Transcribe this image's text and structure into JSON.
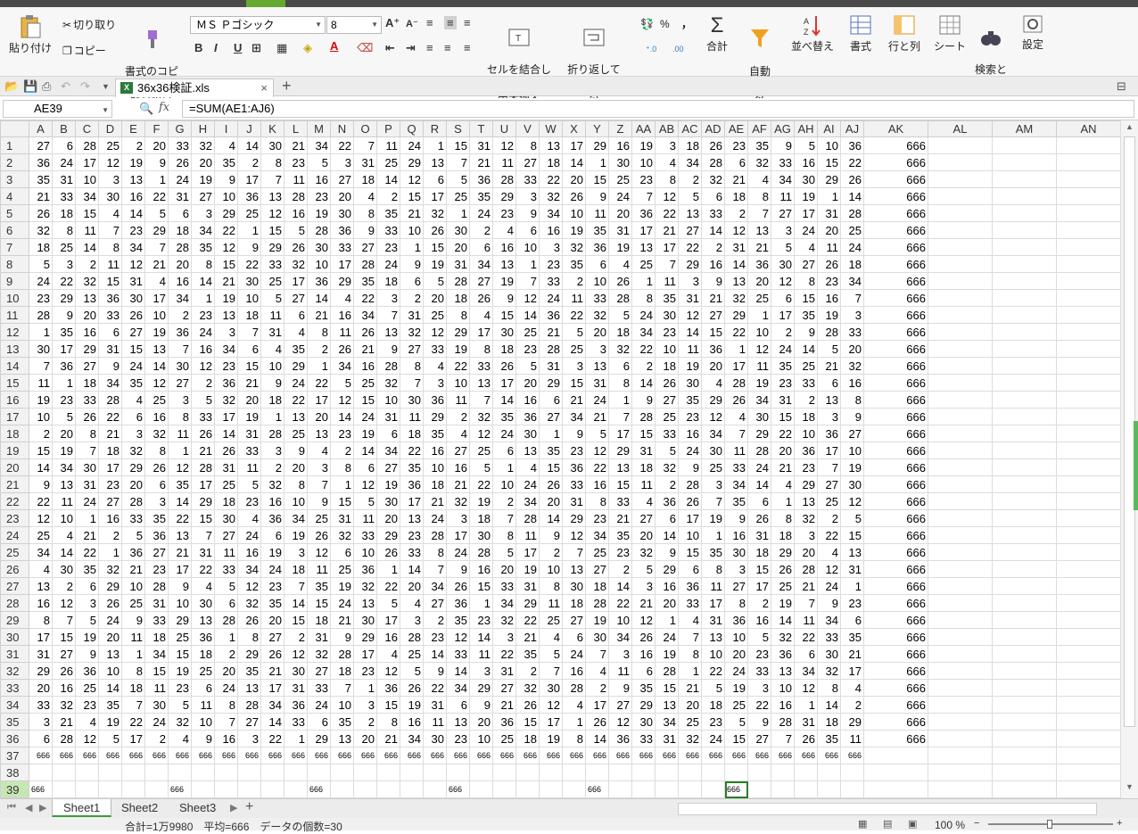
{
  "ribbon": {
    "paste": "貼り付け",
    "cut": "切り取り",
    "copy": "コピー",
    "format_painter": "書式のコピー/\n貼り付け",
    "font_name": "ＭＳ Ｐゴシック",
    "font_size": "8",
    "merge_center": "セルを結合して\n中央揃え",
    "wrap_text": "折り返して\n全体を表示する",
    "sum": "合計",
    "autofilter": "自動\nフィルタ",
    "sort": "並べ替え",
    "format": "書式",
    "rows_cols": "行と列",
    "sheet": "シート",
    "find_select": "検索と\n選択",
    "settings": "設定",
    "percent": "%",
    "comma": "，"
  },
  "file_tab": "36x36検証.xls",
  "name_box": "AE39",
  "formula": "=SUM(AE1:AJ6)",
  "fx": "fx",
  "columns": [
    "A",
    "B",
    "C",
    "D",
    "E",
    "F",
    "G",
    "H",
    "I",
    "J",
    "K",
    "L",
    "M",
    "N",
    "O",
    "P",
    "Q",
    "R",
    "S",
    "T",
    "U",
    "V",
    "W",
    "X",
    "Y",
    "Z",
    "AA",
    "AB",
    "AC",
    "AD",
    "AE",
    "AF",
    "AG",
    "AH",
    "AI",
    "AJ",
    "AK",
    "AL",
    "AM",
    "AN"
  ],
  "highlight_columns": [
    "G",
    "M",
    "S",
    "Y",
    "AE"
  ],
  "rows": [
    [
      27,
      6,
      28,
      25,
      2,
      20,
      33,
      32,
      4,
      14,
      30,
      21,
      34,
      22,
      7,
      11,
      24,
      1,
      15,
      31,
      12,
      8,
      13,
      17,
      29,
      16,
      19,
      3,
      18,
      26,
      23,
      35,
      9,
      5,
      10,
      36
    ],
    [
      36,
      24,
      17,
      12,
      19,
      9,
      26,
      20,
      35,
      2,
      8,
      23,
      5,
      3,
      31,
      25,
      29,
      13,
      7,
      21,
      11,
      27,
      18,
      14,
      1,
      30,
      10,
      4,
      34,
      28,
      6,
      32,
      33,
      16,
      15,
      22
    ],
    [
      35,
      31,
      10,
      3,
      13,
      1,
      24,
      19,
      9,
      17,
      7,
      11,
      16,
      27,
      18,
      14,
      12,
      6,
      5,
      36,
      28,
      33,
      22,
      20,
      15,
      25,
      23,
      8,
      2,
      32,
      21,
      4,
      34,
      30,
      29,
      26
    ],
    [
      21,
      33,
      34,
      30,
      16,
      22,
      31,
      27,
      10,
      36,
      13,
      28,
      23,
      20,
      4,
      2,
      15,
      17,
      25,
      35,
      29,
      3,
      32,
      26,
      9,
      24,
      7,
      12,
      5,
      6,
      18,
      8,
      11,
      19,
      1,
      14
    ],
    [
      26,
      18,
      15,
      4,
      14,
      5,
      6,
      3,
      29,
      25,
      12,
      16,
      19,
      30,
      8,
      35,
      21,
      32,
      1,
      24,
      23,
      9,
      34,
      10,
      11,
      20,
      36,
      22,
      13,
      33,
      2,
      7,
      27,
      17,
      31,
      28
    ],
    [
      32,
      8,
      11,
      7,
      23,
      29,
      18,
      34,
      22,
      1,
      15,
      5,
      28,
      36,
      9,
      33,
      10,
      26,
      30,
      2,
      4,
      6,
      16,
      19,
      35,
      31,
      17,
      21,
      27,
      14,
      12,
      13,
      3,
      24,
      20,
      25
    ],
    [
      18,
      25,
      14,
      8,
      34,
      7,
      28,
      35,
      12,
      9,
      29,
      26,
      30,
      33,
      27,
      23,
      1,
      15,
      20,
      6,
      16,
      10,
      3,
      32,
      36,
      19,
      13,
      17,
      22,
      2,
      31,
      21,
      5,
      4,
      11,
      24
    ],
    [
      5,
      3,
      2,
      11,
      12,
      21,
      20,
      8,
      15,
      22,
      33,
      32,
      10,
      17,
      28,
      24,
      9,
      19,
      31,
      34,
      13,
      1,
      23,
      35,
      6,
      4,
      25,
      7,
      29,
      16,
      14,
      36,
      30,
      27,
      26,
      18
    ],
    [
      24,
      22,
      32,
      15,
      31,
      4,
      16,
      14,
      21,
      30,
      25,
      17,
      36,
      29,
      35,
      18,
      6,
      5,
      28,
      27,
      19,
      7,
      33,
      2,
      10,
      26,
      1,
      11,
      3,
      9,
      13,
      20,
      12,
      8,
      23,
      34
    ],
    [
      23,
      29,
      13,
      36,
      30,
      17,
      34,
      1,
      19,
      10,
      5,
      27,
      14,
      4,
      22,
      3,
      2,
      20,
      18,
      26,
      9,
      12,
      24,
      11,
      33,
      28,
      8,
      35,
      31,
      21,
      32,
      25,
      6,
      15,
      16,
      7
    ],
    [
      28,
      9,
      20,
      33,
      26,
      10,
      2,
      23,
      13,
      18,
      11,
      6,
      21,
      16,
      34,
      7,
      31,
      25,
      8,
      4,
      15,
      14,
      36,
      22,
      32,
      5,
      24,
      30,
      12,
      27,
      29,
      1,
      17,
      35,
      19,
      3
    ],
    [
      1,
      35,
      16,
      6,
      27,
      19,
      36,
      24,
      3,
      7,
      31,
      4,
      8,
      11,
      26,
      13,
      32,
      12,
      29,
      17,
      30,
      25,
      21,
      5,
      20,
      18,
      34,
      23,
      14,
      15,
      22,
      10,
      2,
      9,
      28,
      33
    ],
    [
      30,
      17,
      29,
      31,
      15,
      13,
      7,
      16,
      34,
      6,
      4,
      35,
      2,
      26,
      21,
      9,
      27,
      33,
      19,
      8,
      18,
      23,
      28,
      25,
      3,
      32,
      22,
      10,
      11,
      36,
      1,
      12,
      24,
      14,
      5,
      20
    ],
    [
      7,
      36,
      27,
      9,
      24,
      14,
      30,
      12,
      23,
      15,
      10,
      29,
      1,
      34,
      16,
      28,
      8,
      4,
      22,
      33,
      26,
      5,
      31,
      3,
      13,
      6,
      2,
      18,
      19,
      20,
      17,
      11,
      35,
      25,
      21,
      32
    ],
    [
      11,
      1,
      18,
      34,
      35,
      12,
      27,
      2,
      36,
      21,
      9,
      24,
      22,
      5,
      25,
      32,
      7,
      3,
      10,
      13,
      17,
      20,
      29,
      15,
      31,
      8,
      14,
      26,
      30,
      4,
      28,
      19,
      23,
      33,
      6,
      16
    ],
    [
      19,
      23,
      33,
      28,
      4,
      25,
      3,
      5,
      32,
      20,
      18,
      22,
      17,
      12,
      15,
      10,
      30,
      36,
      11,
      7,
      14,
      16,
      6,
      21,
      24,
      1,
      9,
      27,
      35,
      29,
      26,
      34,
      31,
      2,
      13,
      8
    ],
    [
      10,
      5,
      26,
      22,
      6,
      16,
      8,
      33,
      17,
      19,
      1,
      13,
      20,
      14,
      24,
      31,
      11,
      29,
      2,
      32,
      35,
      36,
      27,
      34,
      21,
      7,
      28,
      25,
      23,
      12,
      4,
      30,
      15,
      18,
      3,
      9
    ],
    [
      2,
      20,
      8,
      21,
      3,
      32,
      11,
      26,
      14,
      31,
      28,
      25,
      13,
      23,
      19,
      6,
      18,
      35,
      4,
      12,
      24,
      30,
      1,
      9,
      5,
      17,
      15,
      33,
      16,
      34,
      7,
      29,
      22,
      10,
      36,
      27
    ],
    [
      15,
      19,
      7,
      18,
      32,
      8,
      1,
      21,
      26,
      33,
      3,
      9,
      4,
      2,
      14,
      34,
      22,
      16,
      27,
      25,
      6,
      13,
      35,
      23,
      12,
      29,
      31,
      5,
      24,
      30,
      11,
      28,
      20,
      36,
      17,
      10
    ],
    [
      14,
      34,
      30,
      17,
      29,
      26,
      12,
      28,
      31,
      11,
      2,
      20,
      3,
      8,
      6,
      27,
      35,
      10,
      16,
      5,
      1,
      4,
      15,
      36,
      22,
      13,
      18,
      32,
      9,
      25,
      33,
      24,
      21,
      23,
      7,
      19
    ],
    [
      9,
      13,
      31,
      23,
      20,
      6,
      35,
      17,
      25,
      5,
      32,
      8,
      7,
      1,
      12,
      19,
      36,
      18,
      21,
      22,
      10,
      24,
      26,
      33,
      16,
      15,
      11,
      2,
      28,
      3,
      34,
      14,
      4,
      29,
      27,
      30
    ],
    [
      22,
      11,
      24,
      27,
      28,
      3,
      14,
      29,
      18,
      23,
      16,
      10,
      9,
      15,
      5,
      30,
      17,
      21,
      32,
      19,
      2,
      34,
      20,
      31,
      8,
      33,
      4,
      36,
      26,
      7,
      35,
      6,
      1,
      13,
      25,
      12
    ],
    [
      12,
      10,
      1,
      16,
      33,
      35,
      22,
      15,
      30,
      4,
      36,
      34,
      25,
      31,
      11,
      20,
      13,
      24,
      3,
      18,
      7,
      28,
      14,
      29,
      23,
      21,
      27,
      6,
      17,
      19,
      9,
      26,
      8,
      32,
      2,
      5
    ],
    [
      25,
      4,
      21,
      2,
      5,
      36,
      13,
      7,
      27,
      24,
      6,
      19,
      26,
      32,
      33,
      29,
      23,
      28,
      17,
      30,
      8,
      11,
      9,
      12,
      34,
      35,
      20,
      14,
      10,
      1,
      16,
      31,
      18,
      3,
      22,
      15
    ],
    [
      34,
      14,
      22,
      1,
      36,
      27,
      21,
      31,
      11,
      16,
      19,
      3,
      12,
      6,
      10,
      26,
      33,
      8,
      24,
      28,
      5,
      17,
      2,
      7,
      25,
      23,
      32,
      9,
      15,
      35,
      30,
      18,
      29,
      20,
      4,
      13
    ],
    [
      4,
      30,
      35,
      32,
      21,
      23,
      17,
      22,
      33,
      34,
      24,
      18,
      11,
      25,
      36,
      1,
      14,
      7,
      9,
      16,
      20,
      19,
      10,
      13,
      27,
      2,
      5,
      29,
      6,
      8,
      3,
      15,
      26,
      28,
      12,
      31
    ],
    [
      13,
      2,
      6,
      29,
      10,
      28,
      9,
      4,
      5,
      12,
      23,
      7,
      35,
      19,
      32,
      22,
      20,
      34,
      26,
      15,
      33,
      31,
      8,
      30,
      18,
      14,
      3,
      16,
      36,
      11,
      27,
      17,
      25,
      21,
      24,
      1
    ],
    [
      16,
      12,
      3,
      26,
      25,
      31,
      10,
      30,
      6,
      32,
      35,
      14,
      15,
      24,
      13,
      5,
      4,
      27,
      36,
      1,
      34,
      29,
      11,
      18,
      28,
      22,
      21,
      20,
      33,
      17,
      8,
      2,
      19,
      7,
      9,
      23
    ],
    [
      8,
      7,
      5,
      24,
      9,
      33,
      29,
      13,
      28,
      26,
      20,
      15,
      18,
      21,
      30,
      17,
      3,
      2,
      35,
      23,
      32,
      22,
      25,
      27,
      19,
      10,
      12,
      1,
      4,
      31,
      36,
      16,
      14,
      11,
      34,
      6
    ],
    [
      17,
      15,
      19,
      20,
      11,
      18,
      25,
      36,
      1,
      8,
      27,
      2,
      31,
      9,
      29,
      16,
      28,
      23,
      12,
      14,
      3,
      21,
      4,
      6,
      30,
      34,
      26,
      24,
      7,
      13,
      10,
      5,
      32,
      22,
      33,
      35
    ],
    [
      31,
      27,
      9,
      13,
      1,
      34,
      15,
      18,
      2,
      29,
      26,
      12,
      32,
      28,
      17,
      4,
      25,
      14,
      33,
      11,
      22,
      35,
      5,
      24,
      7,
      3,
      16,
      19,
      8,
      10,
      20,
      23,
      36,
      6,
      30,
      21
    ],
    [
      29,
      26,
      36,
      10,
      8,
      15,
      19,
      25,
      20,
      35,
      21,
      30,
      27,
      18,
      23,
      12,
      5,
      9,
      14,
      3,
      31,
      2,
      7,
      16,
      4,
      11,
      6,
      28,
      1,
      22,
      24,
      33,
      13,
      34,
      32,
      17
    ],
    [
      20,
      16,
      25,
      14,
      18,
      11,
      23,
      6,
      24,
      13,
      17,
      31,
      33,
      7,
      1,
      36,
      26,
      22,
      34,
      29,
      27,
      32,
      30,
      28,
      2,
      9,
      35,
      15,
      21,
      5,
      19,
      3,
      10,
      12,
      8,
      4
    ],
    [
      33,
      32,
      23,
      35,
      7,
      30,
      5,
      11,
      8,
      28,
      34,
      36,
      24,
      10,
      3,
      15,
      19,
      31,
      6,
      9,
      21,
      26,
      12,
      4,
      17,
      27,
      29,
      13,
      20,
      18,
      25,
      22,
      16,
      1,
      14,
      2
    ],
    [
      3,
      21,
      4,
      19,
      22,
      24,
      32,
      10,
      7,
      27,
      14,
      33,
      6,
      35,
      2,
      8,
      16,
      11,
      13,
      20,
      36,
      15,
      17,
      1,
      26,
      12,
      30,
      34,
      25,
      23,
      5,
      9,
      28,
      31,
      18,
      29
    ],
    [
      6,
      28,
      12,
      5,
      17,
      2,
      4,
      9,
      16,
      3,
      22,
      1,
      29,
      13,
      20,
      21,
      34,
      30,
      23,
      10,
      25,
      18,
      19,
      8,
      14,
      36,
      33,
      31,
      32,
      24,
      15,
      27,
      7,
      26,
      35,
      11
    ]
  ],
  "row_sum": 666,
  "col_sum_small": "666",
  "row39_cols": [
    "A",
    "G",
    "M",
    "S",
    "Y",
    "AE"
  ],
  "sheets": [
    "Sheet1",
    "Sheet2",
    "Sheet3"
  ],
  "status": "合計=1万9980　平均=666　データの個数=30",
  "zoom": "100 %"
}
